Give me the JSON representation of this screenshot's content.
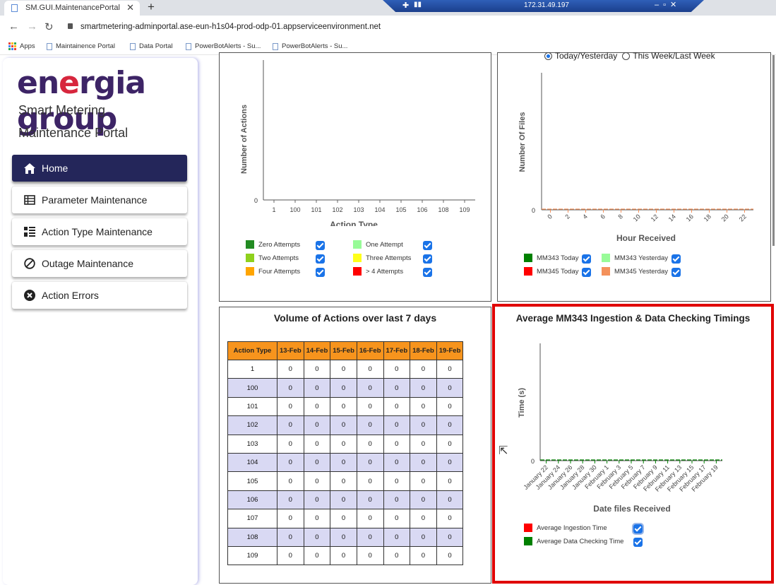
{
  "browser": {
    "tab_title": "SM.GUI.MaintenancePortal",
    "tab_close": "✕",
    "new_tab": "+",
    "remote_ip": "172.31.49.197",
    "url": "smartmetering-adminportal.ase-eun-h1s04-prod-odp-01.appserviceenvironment.net",
    "bookmarks": [
      "Apps",
      "Maintainence Portal",
      "Data Portal",
      "PowerBotAlerts - Su...",
      "PowerBotAlerts - Su..."
    ]
  },
  "sidebar": {
    "logo_parts": [
      "en",
      "e",
      "rgia group"
    ],
    "title_line1": "Smart Metering",
    "title_line2": "Maintenance Portal",
    "items": [
      {
        "label": "Home",
        "icon": "home-icon",
        "active": true
      },
      {
        "label": "Parameter Maintenance",
        "icon": "table-icon",
        "active": false
      },
      {
        "label": "Action Type Maintenance",
        "icon": "list-icon",
        "active": false
      },
      {
        "label": "Outage Maintenance",
        "icon": "prohibited-icon",
        "active": false
      },
      {
        "label": "Action Errors",
        "icon": "error-circle-icon",
        "active": false
      }
    ]
  },
  "action_chart": {
    "chart_data": {
      "type": "bar",
      "xlabel": "Action Type",
      "ylabel": "Number of Actions",
      "categories": [
        "1",
        "100",
        "101",
        "102",
        "103",
        "104",
        "105",
        "106",
        "108",
        "109"
      ],
      "yticks": [
        "0"
      ],
      "series": [
        {
          "name": "Zero Attempts",
          "color": "#228b22",
          "values": [
            0,
            0,
            0,
            0,
            0,
            0,
            0,
            0,
            0,
            0
          ]
        },
        {
          "name": "One Attempt",
          "color": "#98fb98",
          "values": [
            0,
            0,
            0,
            0,
            0,
            0,
            0,
            0,
            0,
            0
          ]
        },
        {
          "name": "Two Attempts",
          "color": "#8fd11d",
          "values": [
            0,
            0,
            0,
            0,
            0,
            0,
            0,
            0,
            0,
            0
          ]
        },
        {
          "name": "Three Attempts",
          "color": "#ffff1a",
          "values": [
            0,
            0,
            0,
            0,
            0,
            0,
            0,
            0,
            0,
            0
          ]
        },
        {
          "name": "Four Attempts",
          "color": "#ffa500",
          "values": [
            0,
            0,
            0,
            0,
            0,
            0,
            0,
            0,
            0,
            0
          ]
        },
        {
          "name": "> 4 Attempts",
          "color": "#ff0000",
          "values": [
            0,
            0,
            0,
            0,
            0,
            0,
            0,
            0,
            0,
            0
          ]
        }
      ]
    }
  },
  "files_chart": {
    "radio_options": [
      "Today/Yesterday",
      "This Week/Last Week"
    ],
    "radio_selected": "Today/Yesterday",
    "chart_data": {
      "type": "line",
      "xlabel": "Hour Received",
      "ylabel": "Number Of Files",
      "x": [
        "0",
        "2",
        "4",
        "6",
        "8",
        "10",
        "12",
        "14",
        "16",
        "18",
        "20",
        "22"
      ],
      "yticks": [
        "0"
      ],
      "series": [
        {
          "name": "MM343 Today",
          "color": "#008000",
          "values": [
            0,
            0,
            0,
            0,
            0,
            0,
            0,
            0,
            0,
            0,
            0,
            0
          ]
        },
        {
          "name": "MM343 Yesterday",
          "color": "#98fb98",
          "values": [
            0,
            0,
            0,
            0,
            0,
            0,
            0,
            0,
            0,
            0,
            0,
            0
          ]
        },
        {
          "name": "MM345 Today",
          "color": "#ff0000",
          "values": [
            0,
            0,
            0,
            0,
            0,
            0,
            0,
            0,
            0,
            0,
            0,
            0
          ]
        },
        {
          "name": "MM345 Yesterday",
          "color": "#f4915b",
          "values": [
            0,
            0,
            0,
            0,
            0,
            0,
            0,
            0,
            0,
            0,
            0,
            0
          ]
        }
      ]
    }
  },
  "volume_table": {
    "title": "Volume of Actions over last 7 days",
    "headers": [
      "Action Type",
      "13-Feb",
      "14-Feb",
      "15-Feb",
      "16-Feb",
      "17-Feb",
      "18-Feb",
      "19-Feb"
    ],
    "rows": [
      [
        "1",
        "0",
        "0",
        "0",
        "0",
        "0",
        "0",
        "0"
      ],
      [
        "100",
        "0",
        "0",
        "0",
        "0",
        "0",
        "0",
        "0"
      ],
      [
        "101",
        "0",
        "0",
        "0",
        "0",
        "0",
        "0",
        "0"
      ],
      [
        "102",
        "0",
        "0",
        "0",
        "0",
        "0",
        "0",
        "0"
      ],
      [
        "103",
        "0",
        "0",
        "0",
        "0",
        "0",
        "0",
        "0"
      ],
      [
        "104",
        "0",
        "0",
        "0",
        "0",
        "0",
        "0",
        "0"
      ],
      [
        "105",
        "0",
        "0",
        "0",
        "0",
        "0",
        "0",
        "0"
      ],
      [
        "106",
        "0",
        "0",
        "0",
        "0",
        "0",
        "0",
        "0"
      ],
      [
        "107",
        "0",
        "0",
        "0",
        "0",
        "0",
        "0",
        "0"
      ],
      [
        "108",
        "0",
        "0",
        "0",
        "0",
        "0",
        "0",
        "0"
      ],
      [
        "109",
        "0",
        "0",
        "0",
        "0",
        "0",
        "0",
        "0"
      ]
    ]
  },
  "timings_chart": {
    "title": "Average MM343 Ingestion & Data Checking Timings",
    "chart_data": {
      "type": "line",
      "xlabel": "Date files Received",
      "ylabel": "Time (s)",
      "x": [
        "January 22",
        "January 24",
        "January 26",
        "January 28",
        "January 30",
        "February 1",
        "February 3",
        "February 5",
        "February 7",
        "February 9",
        "February 11",
        "February 13",
        "February 15",
        "February 17",
        "February 19"
      ],
      "yticks": [
        "0"
      ],
      "series": [
        {
          "name": "Average Ingestion Time",
          "color": "#ff0000",
          "values": [
            0,
            0,
            0,
            0,
            0,
            0,
            0,
            0,
            0,
            0,
            0,
            0,
            0,
            0,
            0
          ]
        },
        {
          "name": "Average Data Checking Time",
          "color": "#008000",
          "values": [
            0,
            0,
            0,
            0,
            0,
            0,
            0,
            0,
            0,
            0,
            0,
            0,
            0,
            0,
            0
          ]
        }
      ]
    }
  }
}
